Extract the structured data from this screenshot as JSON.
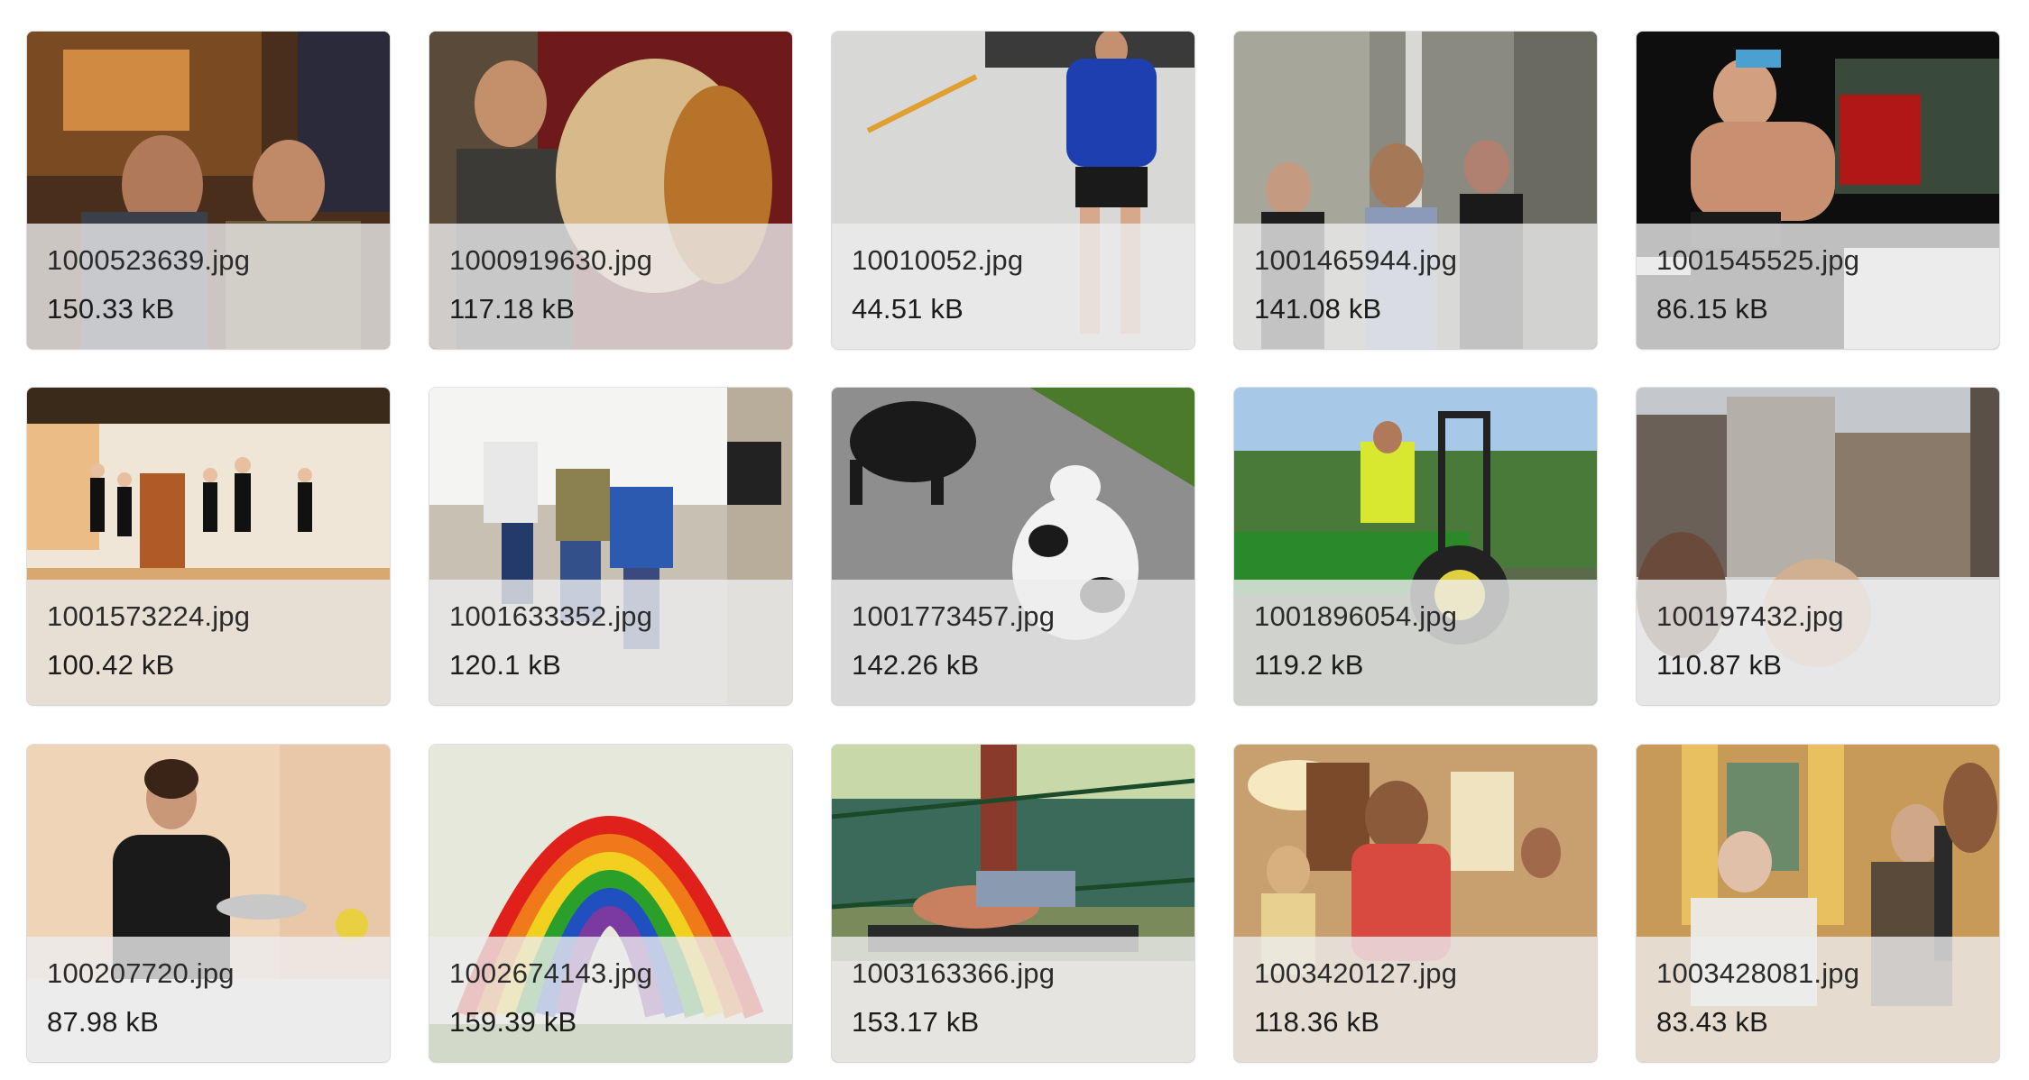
{
  "gallery": {
    "items": [
      {
        "filename": "1000523639.jpg",
        "size": "150.33 kB",
        "thumbnail": "two-men-playing-guitar-photo"
      },
      {
        "filename": "1000919630.jpg",
        "size": "117.18 kB",
        "thumbnail": "man-with-lion-plush-photo"
      },
      {
        "filename": "10010052.jpg",
        "size": "44.51 kB",
        "thumbnail": "woman-in-blue-shirt-photo"
      },
      {
        "filename": "1001465944.jpg",
        "size": "141.08 kB",
        "thumbnail": "people-on-street-photo"
      },
      {
        "filename": "1001545525.jpg",
        "size": "86.15 kB",
        "thumbnail": "man-jumping-photo"
      },
      {
        "filename": "1001573224.jpg",
        "size": "100.42 kB",
        "thumbnail": "ballet-dancers-photo"
      },
      {
        "filename": "1001633352.jpg",
        "size": "120.1 kB",
        "thumbnail": "people-jumping-stairs-photo"
      },
      {
        "filename": "1001773457.jpg",
        "size": "142.26 kB",
        "thumbnail": "two-dogs-playing-photo"
      },
      {
        "filename": "1001896054.jpg",
        "size": "119.2 kB",
        "thumbnail": "man-on-tractor-photo"
      },
      {
        "filename": "100197432.jpg",
        "size": "110.87 kB",
        "thumbnail": "city-buildings-photo"
      },
      {
        "filename": "100207720.jpg",
        "size": "87.98 kB",
        "thumbnail": "woman-with-sieve-photo"
      },
      {
        "filename": "1002674143.jpg",
        "size": "159.39 kB",
        "thumbnail": "rainbow-painting-photo"
      },
      {
        "filename": "1003163366.jpg",
        "size": "153.17 kB",
        "thumbnail": "man-lying-on-bench-photo"
      },
      {
        "filename": "1003420127.jpg",
        "size": "118.36 kB",
        "thumbnail": "music-room-photo"
      },
      {
        "filename": "1003428081.jpg",
        "size": "83.43 kB",
        "thumbnail": "violin-players-photo"
      }
    ]
  }
}
